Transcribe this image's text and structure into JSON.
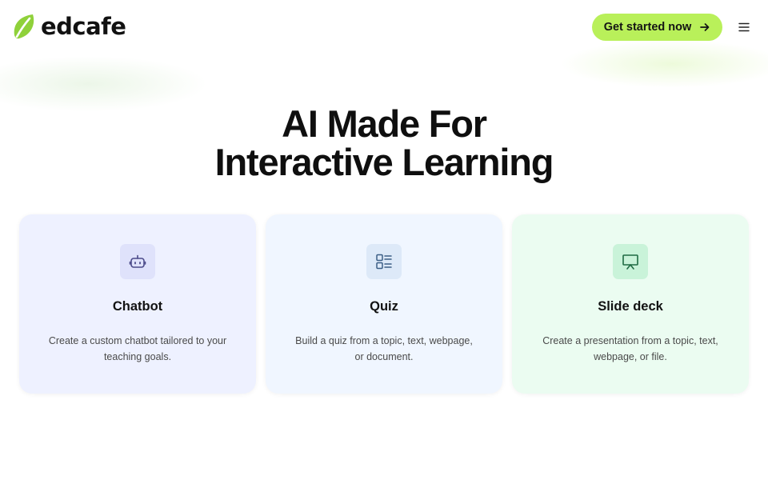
{
  "header": {
    "logo_text": "edcafe",
    "cta_label": "Get started now",
    "menu_icon": "hamburger-icon"
  },
  "hero": {
    "title_line1": "AI Made For",
    "title_line2": "Interactive Learning"
  },
  "cards": [
    {
      "title": "Chatbot",
      "description": "Create a custom chatbot tailored to your teaching goals.",
      "icon": "robot-icon"
    },
    {
      "title": "Quiz",
      "description": "Build a quiz from a topic, text, webpage, or document.",
      "icon": "quiz-list-icon"
    },
    {
      "title": "Slide deck",
      "description": "Create a presentation from a topic, text, webpage, or file.",
      "icon": "presentation-icon"
    }
  ],
  "colors": {
    "brand_green": "#8fd13a",
    "cta_background": "#b9f05a",
    "chatbot_card": "#eef1ff",
    "quiz_card": "#f0f6ff",
    "slides_card": "#ebfcf1",
    "chatbot_icon_color": "#4b4a8a",
    "quiz_icon_color": "#3c5f86",
    "slides_icon_color": "#1f6b43"
  }
}
